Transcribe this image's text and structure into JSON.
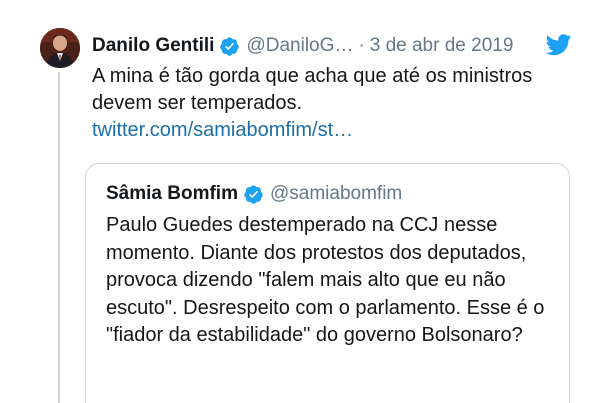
{
  "tweet": {
    "author": {
      "display_name": "Danilo Gentili",
      "handle": "@DaniloG…",
      "verified": true
    },
    "separator": "·",
    "date": "3 de abr de 2019",
    "text": "A mina é tão gorda que acha que até os ministros devem ser temperados.",
    "link": "twitter.com/samiabomfim/st…"
  },
  "quoted_tweet": {
    "author": {
      "display_name": "Sâmia Bomfim",
      "handle": "@samiabomfim",
      "verified": true
    },
    "text": "Paulo Guedes destemperado na CCJ nesse momento. Diante dos protestos dos deputados, provoca dizendo \"falem mais alto que eu não escuto\". Desrespeito com o parlamento. Esse é o \"fiador da estabilidade\" do governo Bolsonaro?"
  },
  "icons": {
    "verified": "verified-badge-icon",
    "brand": "twitter-bird-icon"
  },
  "colors": {
    "brand_blue": "#1da1f2",
    "link_blue": "#1b6fa8",
    "secondary_text": "#657786",
    "border": "#ccd6dd"
  }
}
